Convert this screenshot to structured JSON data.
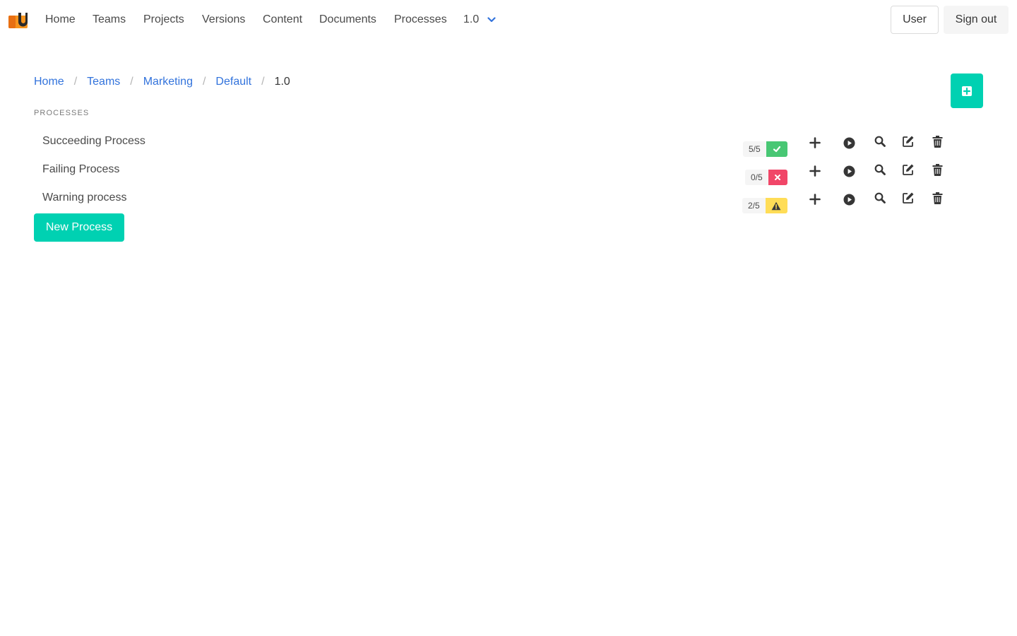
{
  "colors": {
    "primary": "#00d1b2",
    "link": "#3273dc",
    "success": "#48c774",
    "danger": "#f14668",
    "warning": "#ffdd57",
    "logo_orange": "#f7941d"
  },
  "nav": {
    "items": [
      {
        "label": "Home"
      },
      {
        "label": "Teams"
      },
      {
        "label": "Projects"
      },
      {
        "label": "Versions"
      },
      {
        "label": "Content"
      },
      {
        "label": "Documents"
      },
      {
        "label": "Processes"
      }
    ],
    "version": "1.0",
    "user_label": "User",
    "signout_label": "Sign out"
  },
  "breadcrumb": [
    {
      "label": "Home"
    },
    {
      "label": "Teams"
    },
    {
      "label": "Marketing"
    },
    {
      "label": "Default"
    },
    {
      "label": "1.0"
    }
  ],
  "section_title": "PROCESSES",
  "processes": [
    {
      "name": "Succeeding Process",
      "count": "5/5",
      "status": "success",
      "status_icon": "check-icon"
    },
    {
      "name": "Failing Process",
      "count": "0/5",
      "status": "danger",
      "status_icon": "x-icon"
    },
    {
      "name": "Warning process",
      "count": "2/5",
      "status": "warning",
      "status_icon": "warning-icon"
    }
  ],
  "row_actions": [
    "plus-icon",
    "play-icon",
    "search-icon",
    "edit-icon",
    "trash-icon"
  ],
  "new_process_label": "New Process"
}
